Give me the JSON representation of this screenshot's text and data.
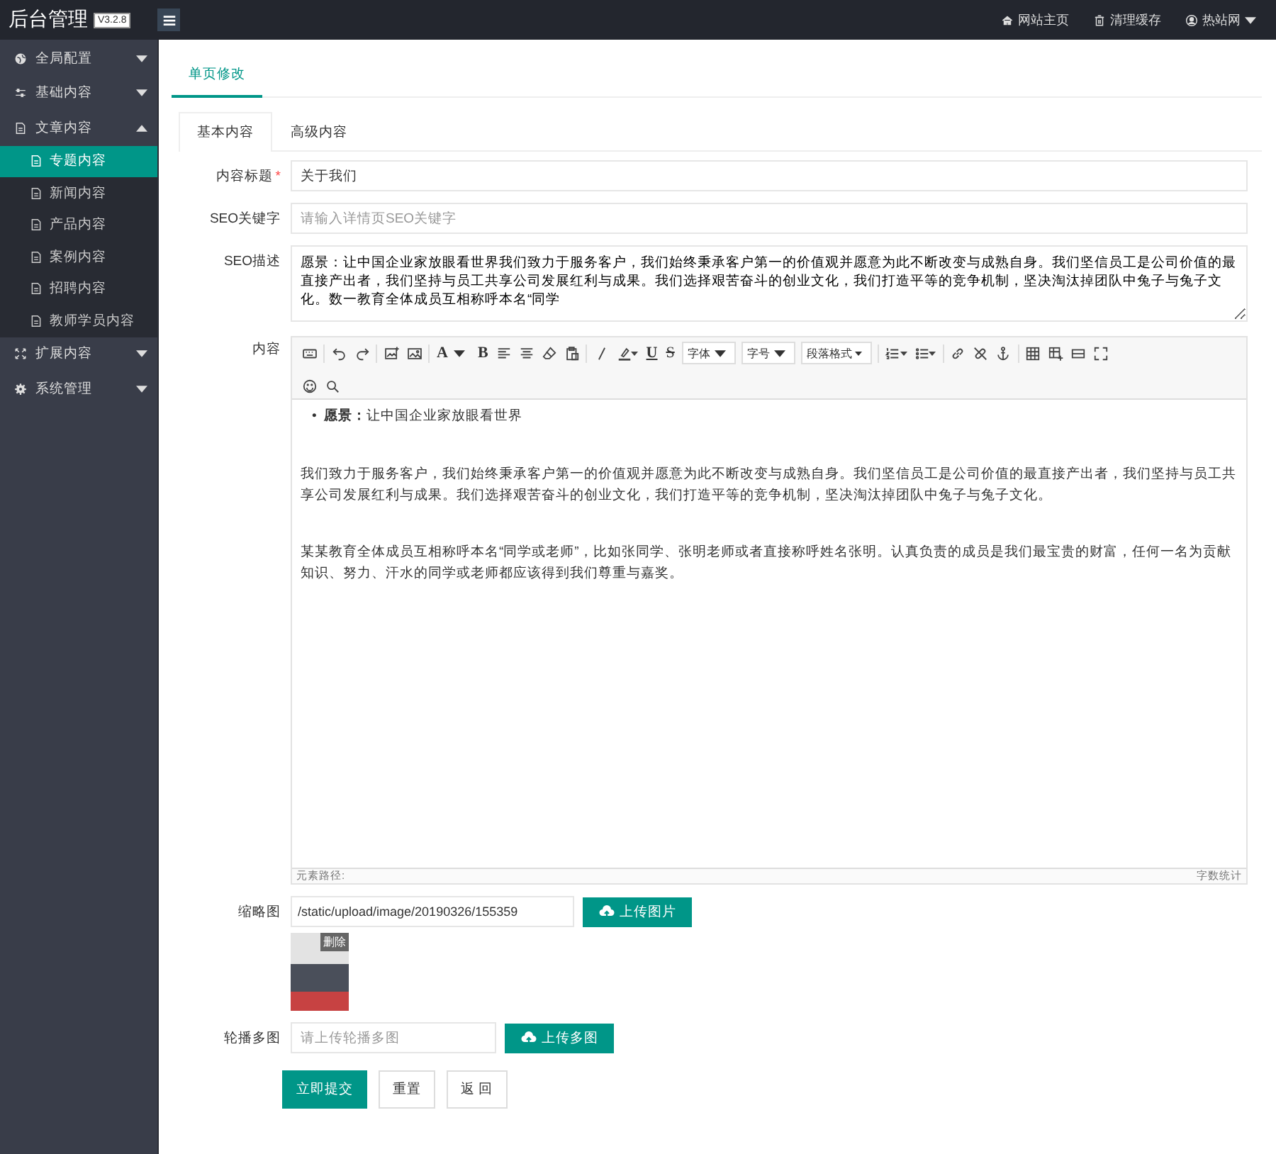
{
  "topbar": {
    "logo": "后台管理",
    "version": "V3.2.8",
    "links": [
      {
        "label": "网站主页"
      },
      {
        "label": "清理缓存"
      },
      {
        "label": "热站网"
      }
    ]
  },
  "sidebar": {
    "items": [
      {
        "label": "全局配置",
        "expanded": false
      },
      {
        "label": "基础内容",
        "expanded": false
      },
      {
        "label": "文章内容",
        "expanded": true,
        "children": [
          {
            "label": "专题内容",
            "selected": true
          },
          {
            "label": "新闻内容",
            "selected": false
          },
          {
            "label": "产品内容",
            "selected": false
          },
          {
            "label": "案例内容",
            "selected": false
          },
          {
            "label": "招聘内容",
            "selected": false
          },
          {
            "label": "教师学员内容",
            "selected": false
          }
        ]
      },
      {
        "label": "扩展内容",
        "expanded": false
      },
      {
        "label": "系统管理",
        "expanded": false
      }
    ]
  },
  "page_tab": {
    "label": "单页修改",
    "selected": true
  },
  "tabs": [
    {
      "label": "基本内容",
      "selected": true
    },
    {
      "label": "高级内容",
      "selected": false
    }
  ],
  "fields": [
    {
      "kind": "text",
      "label": "内容标题",
      "required_mark": "*",
      "value": "关于我们"
    },
    {
      "kind": "text",
      "label": "SEO关键字",
      "placeholder": "请输入详情页SEO关键字"
    },
    {
      "kind": "textarea",
      "label": "SEO描述",
      "value": "愿景：让中国企业家放眼看世界我们致力于服务客户，我们始终秉承客户第一的价值观并愿意为此不断改变与成熟自身。我们坚信员工是公司价值的最直接产出者，我们坚持与员工共享公司发展红利与成果。我们选择艰苦奋斗的创业文化，我们打造平等的竞争机制，坚决淘汰掉团队中兔子与兔子文化。数一教育全体成员互相称呼本名“同学"
    },
    {
      "kind": "editor",
      "label": "内容",
      "glyphs": [
        "A",
        "B",
        "U",
        "S"
      ],
      "selects": [
        "字体",
        "字号",
        "段落格式"
      ],
      "content": [
        {
          "kind": "bullet",
          "marker": "•",
          "text": "**愿景：**让中国企业家放眼看世界"
        },
        {
          "kind": "paragraph",
          "text": "我们致力于服务客户，我们始终秉承客户第一的价值观并愿意为此不断改变与成熟自身。我们坚信员工是公司价值的最直接产出者，我们坚持与员工共享公司发展红利与成果。我们选择艰苦奋斗的创业文化，我们打造平等的竞争机制，坚决淘汰掉团队中兔子与兔子文化。"
        },
        {
          "kind": "paragraph",
          "text": "某某教育全体成员互相称呼本名“同学或老师”，比如张同学、张明老师或者直接称呼姓名张明。认真负责的成员是我们最宝贵的财富，任何一名为贡献知识、努力、汗水的同学或老师都应该得到我们尊重与嘉奖。"
        }
      ],
      "status_left": "元素路径:",
      "status_right": "字数统计"
    },
    {
      "kind": "image",
      "label": "缩略图",
      "value": "/static/upload/image/20190326/155359",
      "button": "上传图片",
      "delete": "删除"
    },
    {
      "kind": "upload",
      "label": "轮播多图",
      "placeholder": "请上传轮播多图",
      "button": "上传多图"
    }
  ],
  "buttons": [
    {
      "label": "立即提交",
      "primary": true
    },
    {
      "label": "重置",
      "primary": false
    },
    {
      "label": "返 回",
      "primary": false
    }
  ]
}
